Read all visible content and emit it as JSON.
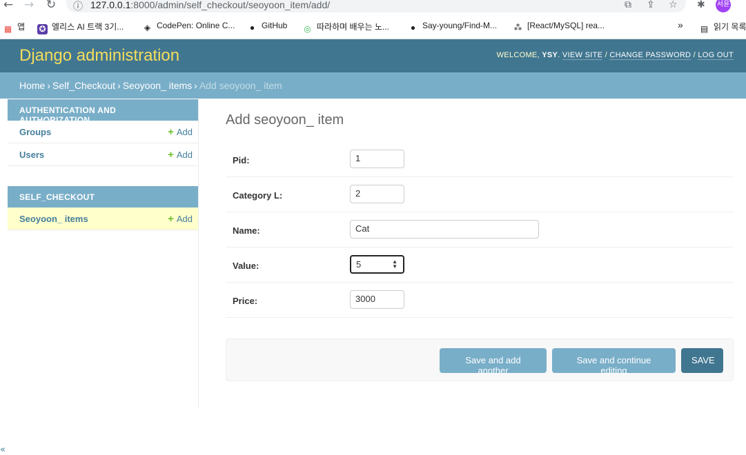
{
  "browser": {
    "url_host": "127.0.0.1",
    "url_path": ":8000/admin/self_checkout/seoyoon_item/add/",
    "profile_label": "서윤",
    "bookmarks": [
      {
        "label": "앱"
      },
      {
        "label": "엘리스 AI 트랙 3기..."
      },
      {
        "label": "CodePen: Online C..."
      },
      {
        "label": "GitHub"
      },
      {
        "label": "따라하며 배우는 노..."
      },
      {
        "label": "Say-young/Find-M..."
      },
      {
        "label": "[React/MySQL] rea..."
      }
    ],
    "more_label": "»",
    "reading_list_label": "읽기 목록"
  },
  "header": {
    "branding": "Django administration",
    "welcome": "Welcome,",
    "username": "ysy",
    "view_site": "View site",
    "change_password": "Change password",
    "log_out": "Log out"
  },
  "breadcrumbs": {
    "home": "Home",
    "app": "Self_Checkout",
    "model": "Seoyoon_ items",
    "current": "Add seoyoon_ item"
  },
  "sidebar": {
    "modules": [
      {
        "caption": "Authentication and Authorization",
        "rows": [
          {
            "name": "Groups",
            "add": "Add"
          },
          {
            "name": "Users",
            "add": "Add"
          }
        ]
      },
      {
        "caption": "SELF_CHECKOUT",
        "rows": [
          {
            "name": "Seoyoon_ items",
            "add": "Add"
          }
        ]
      }
    ],
    "toggle": "«"
  },
  "content": {
    "title": "Add seoyoon_ item",
    "fields": [
      {
        "label": "Pid:",
        "value": "1"
      },
      {
        "label": "Category L:",
        "value": "2"
      },
      {
        "label": "Name:",
        "value": "Cat"
      },
      {
        "label": "Value:",
        "value": "5"
      },
      {
        "label": "Price:",
        "value": "3000"
      }
    ],
    "buttons": {
      "save_add_another": "Save and add another",
      "save_continue": "Save and continue editing",
      "save": "SAVE"
    }
  },
  "colors": {
    "header_bg": "#417690",
    "branding": "#f5dd5d",
    "breadcrumbs_bg": "#79aec8",
    "link": "#447e9b",
    "add_plus": "#70bf2b",
    "current_row": "#ffffcc"
  }
}
